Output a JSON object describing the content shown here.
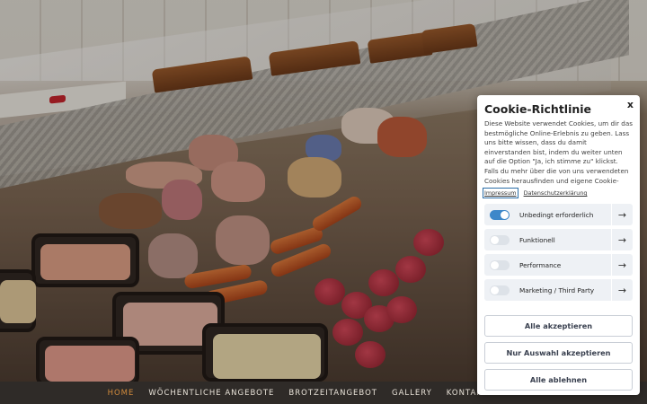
{
  "cookie_panel": {
    "title": "Cookie-Richtlinie",
    "close_label": "x",
    "description": "Diese Website verwendet Cookies, um dir das bestmögliche Online-Erlebnis zu geben. Lass uns bitte wissen, dass du damit einverstanden bist, indem du weiter unten auf die Option \"Ja, ich stimme zu\" klickst. Falls du mehr über die von uns verwendeten Cookies herausfinden und eigene Cookie-Einstellungen vornehmen möchtest, klicke bitte auf \"Einstellungen\".",
    "links": {
      "impressum": "Impressum",
      "datenschutz": "Datenschutzerklärung"
    },
    "categories": [
      {
        "label": "Unbedingt erforderlich",
        "enabled": true,
        "arrow": "→"
      },
      {
        "label": "Funktionell",
        "enabled": false,
        "arrow": "→"
      },
      {
        "label": "Performance",
        "enabled": false,
        "arrow": "→"
      },
      {
        "label": "Marketing / Third Party",
        "enabled": false,
        "arrow": "→"
      }
    ],
    "buttons": {
      "accept_all": "Alle akzeptieren",
      "accept_selection": "Nur Auswahl akzeptieren",
      "reject_all": "Alle ablehnen"
    }
  },
  "nav": {
    "items": [
      "HOME",
      "WÖCHENTLICHE ANGEBOTE",
      "BROTZEITANGEBOT",
      "GALLERY",
      "KONTAKT"
    ],
    "active": "HOME"
  },
  "colors": {
    "nav_bg": "#2f2b28",
    "nav_active": "#d08a3c",
    "toggle_on": "#3d87c9",
    "category_bg": "#eef1f5"
  }
}
